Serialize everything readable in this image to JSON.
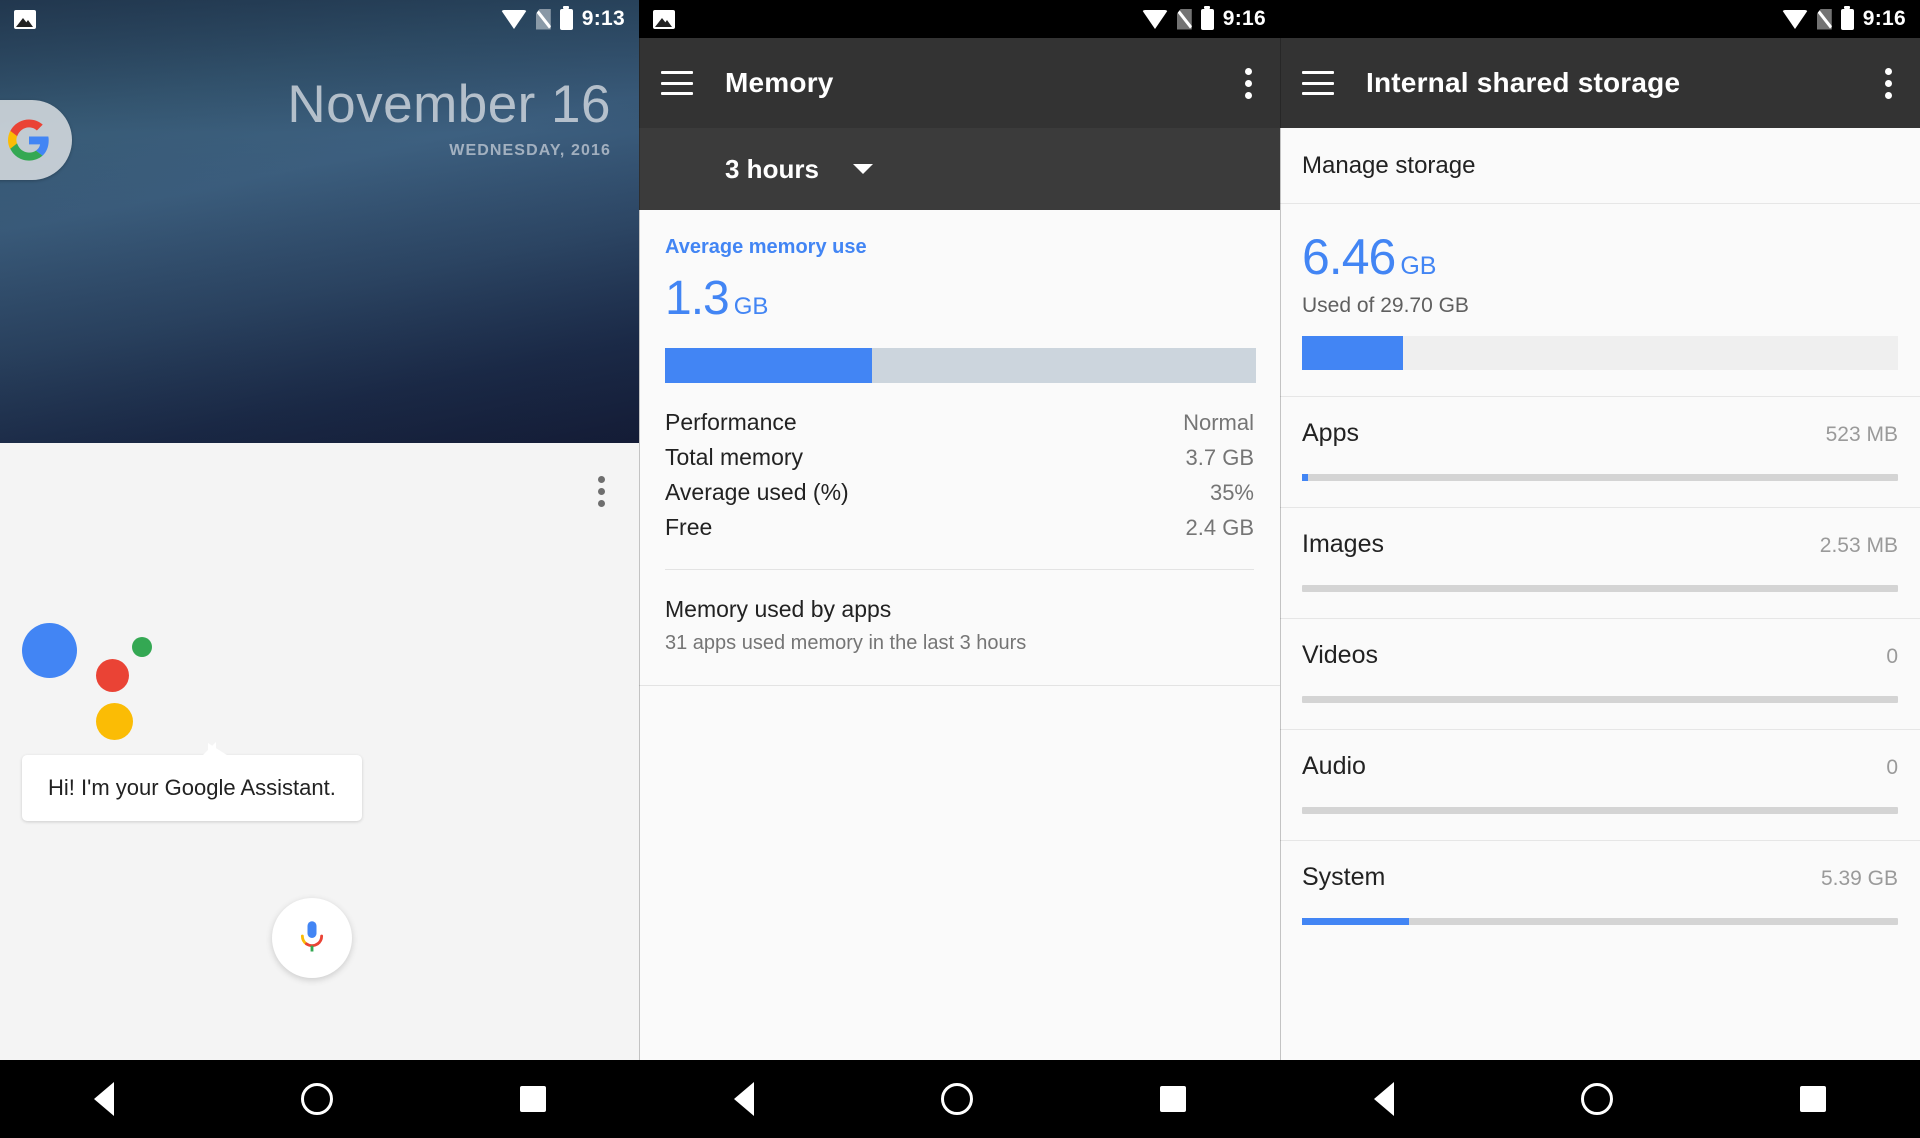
{
  "panel1": {
    "status": {
      "time": "9:13",
      "icons": [
        "photo-icon",
        "wifi-icon",
        "no-sim-icon",
        "battery-icon"
      ]
    },
    "date": {
      "headline": "November 16",
      "subline": "WEDNESDAY, 2016"
    },
    "search_pill": {
      "logo": "google-logo"
    },
    "assistant": {
      "bubble_text": "Hi! I'm your Google Assistant.",
      "mic_label": "mic-icon",
      "dot_colors": {
        "blue": "#4285f4",
        "red": "#ea4335",
        "green": "#34a853",
        "yellow": "#fbbc05"
      }
    },
    "overflow": "overflow-menu"
  },
  "panel2": {
    "status": {
      "time": "9:16"
    },
    "appbar": {
      "title": "Memory",
      "menu_icon": "hamburger-icon",
      "overflow_icon": "overflow-menu-icon"
    },
    "spinner": {
      "value": "3 hours",
      "caret": "chevron-down-icon"
    },
    "summary": {
      "heading": "Average memory use",
      "value": "1.3",
      "unit": "GB",
      "bar_percent": 35,
      "bar_fill_color": "#4285f4",
      "bar_track_color": "#ccd5dd"
    },
    "stats": [
      {
        "label": "Performance",
        "value": "Normal"
      },
      {
        "label": "Total memory",
        "value": "3.7 GB"
      },
      {
        "label": "Average used (%)",
        "value": "35%"
      },
      {
        "label": "Free",
        "value": "2.4 GB"
      }
    ],
    "apps_section": {
      "title": "Memory used by apps",
      "subtitle": "31 apps used memory in the last 3 hours"
    }
  },
  "panel3": {
    "status": {
      "time": "9:16"
    },
    "appbar": {
      "title": "Internal shared storage",
      "menu_icon": "hamburger-icon",
      "overflow_icon": "overflow-menu-icon"
    },
    "manage_storage": "Manage storage",
    "summary": {
      "value": "6.46",
      "unit": "GB",
      "subtitle": "Used of 29.70 GB",
      "bar_percent": 17,
      "bar_fill_color": "#4285f4",
      "bar_track_color": "#efefef"
    },
    "categories": [
      {
        "label": "Apps",
        "value": "523 MB",
        "bar_percent": 1.0
      },
      {
        "label": "Images",
        "value": "2.53 MB",
        "bar_percent": 0
      },
      {
        "label": "Videos",
        "value": "0",
        "bar_percent": 0
      },
      {
        "label": "Audio",
        "value": "0",
        "bar_percent": 0
      },
      {
        "label": "System",
        "value": "5.39 GB",
        "bar_percent": 18
      }
    ]
  },
  "navbar": {
    "buttons": [
      "back-button",
      "home-button",
      "recents-button"
    ]
  }
}
